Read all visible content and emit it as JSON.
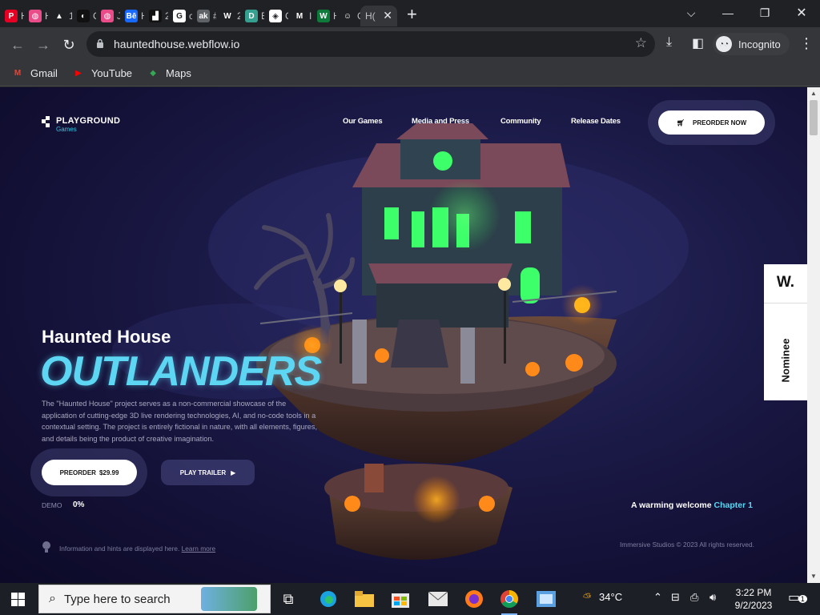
{
  "browser": {
    "tabs": [
      {
        "label": "H",
        "icon": "pinterest-icon",
        "color": "#e60023",
        "glyph": "P"
      },
      {
        "label": "H",
        "icon": "dribbble-icon",
        "color": "#ea4c89",
        "glyph": "◍"
      },
      {
        "label": "1(",
        "icon": "chart-icon",
        "color": "#202124",
        "glyph": "▲"
      },
      {
        "label": "C",
        "icon": "circle-icon",
        "color": "#111111",
        "glyph": "◐"
      },
      {
        "label": "Jc",
        "icon": "dribbble-icon",
        "color": "#ea4c89",
        "glyph": "◍"
      },
      {
        "label": "H",
        "icon": "behance-icon",
        "color": "#1769ff",
        "glyph": "Bē"
      },
      {
        "label": "2",
        "icon": "figure-icon",
        "color": "#111111",
        "glyph": "▟"
      },
      {
        "label": "cc",
        "icon": "google-icon",
        "color": "#ffffff",
        "glyph": "G"
      },
      {
        "label": "#",
        "icon": "grey-icon",
        "color": "#5f6368",
        "glyph": "ak"
      },
      {
        "label": "2",
        "icon": "w-icon",
        "color": "#202124",
        "glyph": "W"
      },
      {
        "label": "B",
        "icon": "d-icon",
        "color": "#35a090",
        "glyph": "D"
      },
      {
        "label": "C",
        "icon": "codepen-icon",
        "color": "#ffffff",
        "glyph": "◈"
      },
      {
        "label": "Ir",
        "icon": "gmail-icon",
        "color": "#202124",
        "glyph": "M"
      },
      {
        "label": "H",
        "icon": "webflow-icon",
        "color": "#0e7a3a",
        "glyph": "W"
      },
      {
        "label": "G",
        "icon": "ghost-icon",
        "color": "#202124",
        "glyph": "☺"
      }
    ],
    "active_tab": {
      "label": "H(",
      "close": "✕"
    },
    "new_tab": "+",
    "window": {
      "minimize": "—",
      "restore": "❐",
      "close": "✕",
      "chevron": "⌵"
    },
    "url": "hauntedhouse.webflow.io",
    "incognito_label": "Incognito",
    "bookmarks": [
      {
        "label": "Gmail",
        "icon": "gmail-icon",
        "color": "#ea4335",
        "glyph": "M"
      },
      {
        "label": "YouTube",
        "icon": "youtube-icon",
        "color": "#ff0000",
        "glyph": "▶"
      },
      {
        "label": "Maps",
        "icon": "maps-icon",
        "color": "#34a853",
        "glyph": "◆"
      }
    ]
  },
  "site": {
    "logo": {
      "name": "PLAYGROUND",
      "sub": "Games"
    },
    "nav": [
      "Our Games",
      "Media and Press",
      "Community",
      "Release Dates"
    ],
    "preorder_now": "PREORDER NOW",
    "subtitle": "Haunted House",
    "title": "OUTLANDERS",
    "description": "The \"Haunted House\" project serves as a non-commercial showcase of the application of cutting-edge 3D live rendering technologies, AI, and no-code tools in a contextual setting. The project is entirely fictional in nature, with all elements, figures, and details being the product of creative imagination.",
    "preorder_btn": "PREORDER",
    "price": "$29.99",
    "play_trailer": "PLAY TRAILER",
    "demo_label": "DEMO",
    "demo_value": "0%",
    "welcome": "A warming welcome",
    "chapter": "Chapter 1",
    "hint": "Information and hints are displayed here.",
    "hint_link": "Learn more",
    "copyright": "Immersive Studios © 2023 All rights reserved.",
    "badge_logo": "W.",
    "badge_text": "Nominee"
  },
  "taskbar": {
    "search_placeholder": "Type here to search",
    "weather": "34°C",
    "time": "3:22 PM",
    "date": "9/2/2023",
    "notifications": "1"
  }
}
